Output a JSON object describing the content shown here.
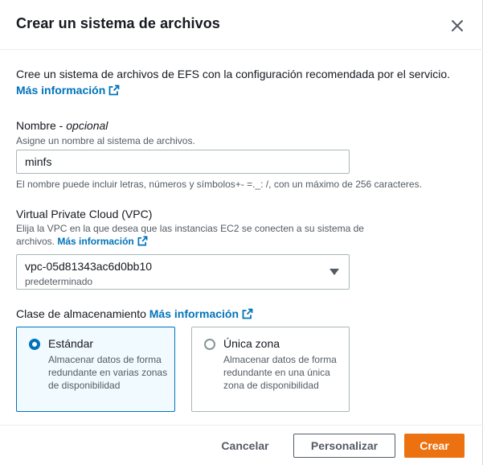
{
  "dialog": {
    "title": "Crear un sistema de archivos",
    "intro": "Cree un sistema de archivos de EFS con la configuración recomendada por el servicio.",
    "learn_more": "Más información"
  },
  "name_field": {
    "label": "Nombre",
    "optional": "opcional",
    "description": "Asigne un nombre al sistema de archivos.",
    "value": "minfs",
    "constraint": "El nombre puede incluir letras, números y símbolos+- =._: /, con un máximo de 256 caracteres."
  },
  "vpc_field": {
    "label": "Virtual Private Cloud (VPC)",
    "description": "Elija la VPC en la que desea que las instancias EC2 se conecten a su sistema de archivos.",
    "learn_more": "Más información",
    "selected_value": "vpc-05d81343ac6d0bb10",
    "selected_sub": "predeterminado"
  },
  "storage_class": {
    "label": "Clase de almacenamiento",
    "learn_more": "Más información",
    "options": [
      {
        "title": "Estándar",
        "description": "Almacenar datos de forma redundante en varias zonas de disponibilidad",
        "selected": true
      },
      {
        "title": "Única zona",
        "description": "Almacenar datos de forma redundante en una única zona de disponibilidad",
        "selected": false
      }
    ]
  },
  "footer": {
    "cancel": "Cancelar",
    "customize": "Personalizar",
    "create": "Crear"
  },
  "colors": {
    "link": "#0073bb",
    "primary": "#ec7211",
    "selected_tile_bg": "#f1faff"
  },
  "icons": [
    "close-icon",
    "external-link-icon",
    "caret-down-icon",
    "radio-selected-icon",
    "radio-unselected-icon"
  ]
}
